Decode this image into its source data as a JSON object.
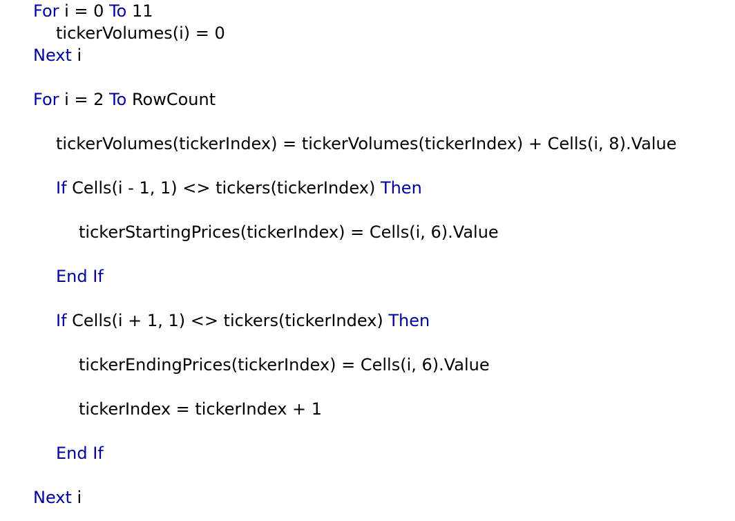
{
  "colors": {
    "keyword": "#0000a0",
    "text": "#000000",
    "background": "#ffffff"
  },
  "lines": [
    {
      "indent": 0,
      "tokens": [
        {
          "kw": true,
          "text": "For"
        },
        {
          "kw": false,
          "text": " i = 0 "
        },
        {
          "kw": true,
          "text": "To"
        },
        {
          "kw": false,
          "text": " 11"
        }
      ]
    },
    {
      "indent": 1,
      "tokens": [
        {
          "kw": false,
          "text": "tickerVolumes(i) = 0"
        }
      ]
    },
    {
      "indent": 0,
      "tokens": [
        {
          "kw": true,
          "text": "Next"
        },
        {
          "kw": false,
          "text": " i"
        }
      ]
    },
    {
      "indent": 0,
      "tokens": [
        {
          "kw": true,
          "text": "For"
        },
        {
          "kw": false,
          "text": " i = 2 "
        },
        {
          "kw": true,
          "text": "To"
        },
        {
          "kw": false,
          "text": " RowCount"
        }
      ]
    },
    {
      "indent": 1,
      "tokens": [
        {
          "kw": false,
          "text": "tickerVolumes(tickerIndex) = tickerVolumes(tickerIndex) + Cells(i, 8).Value"
        }
      ]
    },
    {
      "indent": 1,
      "tokens": [
        {
          "kw": true,
          "text": "If"
        },
        {
          "kw": false,
          "text": " Cells(i - 1, 1) <> tickers(tickerIndex) "
        },
        {
          "kw": true,
          "text": "Then"
        }
      ]
    },
    {
      "indent": 2,
      "tokens": [
        {
          "kw": false,
          "text": "tickerStartingPrices(tickerIndex) = Cells(i, 6).Value"
        }
      ]
    },
    {
      "indent": 1,
      "tokens": [
        {
          "kw": true,
          "text": "End If"
        }
      ]
    },
    {
      "indent": 1,
      "tokens": [
        {
          "kw": true,
          "text": "If"
        },
        {
          "kw": false,
          "text": " Cells(i + 1, 1) <> tickers(tickerIndex) "
        },
        {
          "kw": true,
          "text": "Then"
        }
      ]
    },
    {
      "indent": 2,
      "tokens": [
        {
          "kw": false,
          "text": "tickerEndingPrices(tickerIndex) = Cells(i, 6).Value"
        }
      ]
    },
    {
      "indent": 2,
      "tokens": [
        {
          "kw": false,
          "text": "tickerIndex = tickerIndex + 1"
        }
      ]
    },
    {
      "indent": 1,
      "tokens": [
        {
          "kw": true,
          "text": "End If"
        }
      ]
    },
    {
      "indent": 0,
      "tokens": [
        {
          "kw": true,
          "text": "Next"
        },
        {
          "kw": false,
          "text": " i"
        }
      ]
    }
  ]
}
